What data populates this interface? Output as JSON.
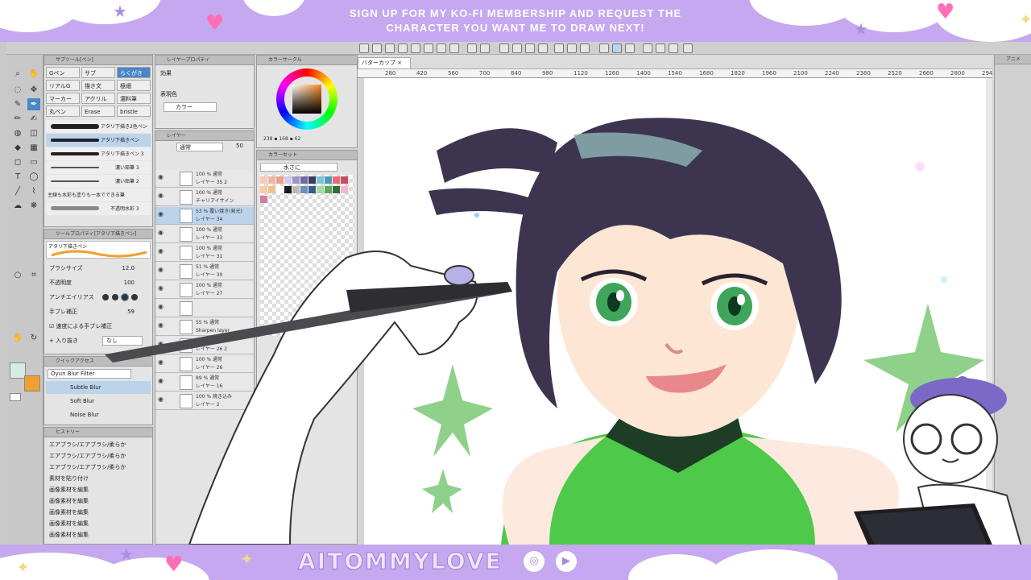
{
  "banner": {
    "top_line1": "SIGN UP FOR MY KO-FI MEMBERSHIP AND REQUEST THE",
    "top_line2": "CHARACTER YOU WANT ME TO DRAW NEXT!",
    "bottom_name": "AITOMMYLOVE",
    "social_icons": [
      "instagram-icon",
      "youtube-icon"
    ]
  },
  "app": {
    "canvas_tab": "バターカップ",
    "ruler_ticks": [
      "280",
      "420",
      "560",
      "700",
      "840",
      "980",
      "1120",
      "1260",
      "1400",
      "1540",
      "1680",
      "1820",
      "1960",
      "2100",
      "2240",
      "2380",
      "2520",
      "2660",
      "2800",
      "2940"
    ],
    "brush_panel": {
      "title": "サブツール[ペン]",
      "tabs": [
        "Gペン",
        "サブ",
        "らくがき",
        "リアルG",
        "描き文",
        "極細",
        "マーカー",
        "アクリル",
        "濃料筆",
        "丸ペン",
        "Erase",
        "bristle"
      ],
      "brushes": [
        "アタリ下描き2色ペン",
        "アタリ下描きペン",
        "アタリ下描きペン 3",
        "濃い鉛筆 3",
        "濃い鉛筆 2",
        "主線も水彩も塗りも一本でできる筆",
        "不透明水彩 3"
      ]
    },
    "tool_property": {
      "title": "ツールプロパティ[アタリ下描きペン]",
      "name": "アタリ下描きペン",
      "brush_size_label": "ブラシサイズ",
      "brush_size_value": "12.0",
      "opacity_label": "不透明度",
      "opacity_value": "100",
      "antialias_label": "アンチエイリアス",
      "stabilization_label": "手ブレ補正",
      "stabilization_value": "59",
      "speed_label": "速度による手ブレ補正",
      "inout_label": "入り抜き",
      "inout_value": "なし"
    },
    "quick_access": {
      "title": "クイックアクセス",
      "filter": "Oyun Blur Filter",
      "items": [
        "Subtle Blur",
        "Soft Blur",
        "Noise Blur"
      ]
    },
    "history": {
      "title": "ヒストリー",
      "items": [
        "エアブラシ/エアブラシ/柔らか",
        "エアブラシ/エアブラシ/柔らか",
        "エアブラシ/エアブラシ/柔らか",
        "素材を貼り付け",
        "画像素材を編集",
        "画像素材を編集",
        "画像素材を編集",
        "画像素材を編集",
        "画像素材を編集"
      ]
    },
    "layer_property": {
      "title": "レイヤープロパティ",
      "effect_label": "効果",
      "color_label": "表現色",
      "color_value": "カラー"
    },
    "layers": {
      "title": "レイヤー",
      "blend": "通常",
      "opacity": "50",
      "items": [
        {
          "l1": "100 % 通常",
          "l2": "レイヤー 35 2"
        },
        {
          "l1": "100 % 通常",
          "l2": "チャリアイサイン"
        },
        {
          "l1": "53 % 覆い焼き(発光)",
          "l2": "レイヤー 34"
        },
        {
          "l1": "100 % 通常",
          "l2": "レイヤー 33"
        },
        {
          "l1": "100 % 通常",
          "l2": "レイヤー 31"
        },
        {
          "l1": "51 % 通常",
          "l2": "レイヤー 30"
        },
        {
          "l1": "100 % 通常",
          "l2": "レイヤー 27"
        },
        {
          "l1": "",
          "l2": ""
        },
        {
          "l1": "55 % 通常",
          "l2": "Sharpen layer"
        },
        {
          "l1": "100 % 通常",
          "l2": "レイヤー 26 2"
        },
        {
          "l1": "100 % 通常",
          "l2": "レイヤー 26"
        },
        {
          "l1": "89 % 通常",
          "l2": "レイヤー 16"
        },
        {
          "l1": "100 % 焼き込み",
          "l2": "レイヤー 2"
        }
      ]
    },
    "color_circle": {
      "title": "カラーサークル",
      "h": "238",
      "s": "168",
      "v": "62"
    },
    "color_set": {
      "title": "カラーセット",
      "set_name": "水さに"
    },
    "right_panel": {
      "title": "アニメ"
    }
  }
}
